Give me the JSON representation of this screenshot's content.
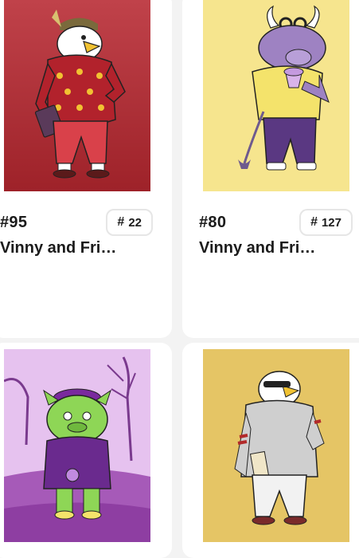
{
  "cards": [
    {
      "number": "#95",
      "rank_symbol": "#",
      "rank": "22",
      "title": "Vinny and Friends",
      "art_label": "eagle-in-red-sweater-artwork",
      "background": "#b3373d"
    },
    {
      "number": "#80",
      "rank_symbol": "#",
      "rank": "127",
      "title": "Vinny and Friends",
      "art_label": "purple-bull-artwork",
      "background": "#f6e58e"
    },
    {
      "number": "",
      "rank_symbol": "",
      "rank": "",
      "title": "",
      "art_label": "green-pig-artwork",
      "background": "#d8a8e0"
    },
    {
      "number": "",
      "rank_symbol": "",
      "rank": "",
      "title": "",
      "art_label": "eagle-in-sunglasses-artwork",
      "background": "#e5c565"
    }
  ]
}
